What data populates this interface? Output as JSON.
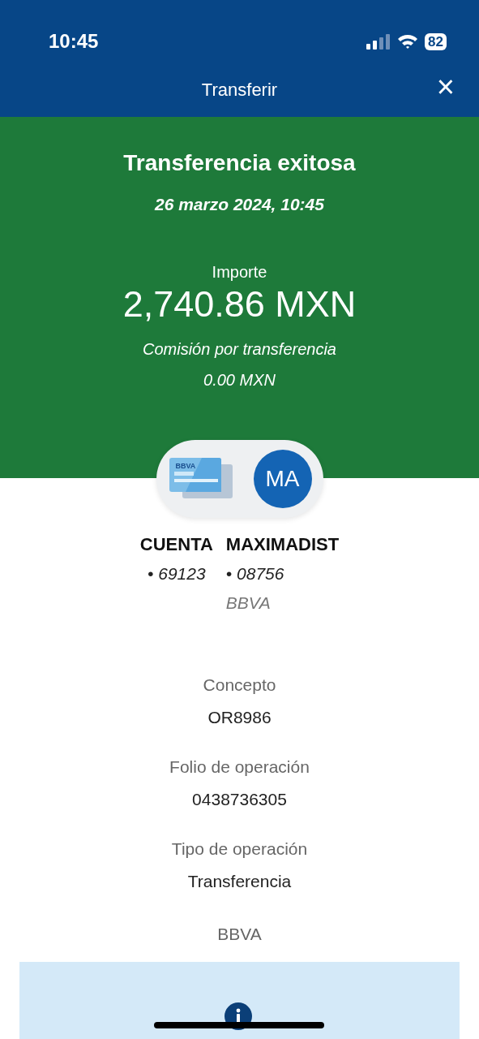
{
  "status_bar": {
    "time": "10:45",
    "battery": "82"
  },
  "header": {
    "title": "Transferir",
    "close": "×"
  },
  "result": {
    "title": "Transferencia exitosa",
    "date": "26 marzo 2024, 10:45",
    "amount_label": "Importe",
    "amount": "2,740.86 MXN",
    "fee_label": "Comisión por transferencia",
    "fee": "0.00 MXN"
  },
  "transfer": {
    "card_logo": "BBVA",
    "initials": "MA",
    "origin": {
      "name": "CUENTA",
      "account": "• 69123"
    },
    "destination": {
      "name": "MAXIMADIST",
      "account": "• 08756",
      "bank": "BBVA"
    }
  },
  "details": [
    {
      "label": "Concepto",
      "value": "OR8986"
    },
    {
      "label": "Folio de operación",
      "value": "0438736305"
    },
    {
      "label": "Tipo de operación",
      "value": "Transferencia"
    }
  ],
  "bank_note": "BBVA"
}
